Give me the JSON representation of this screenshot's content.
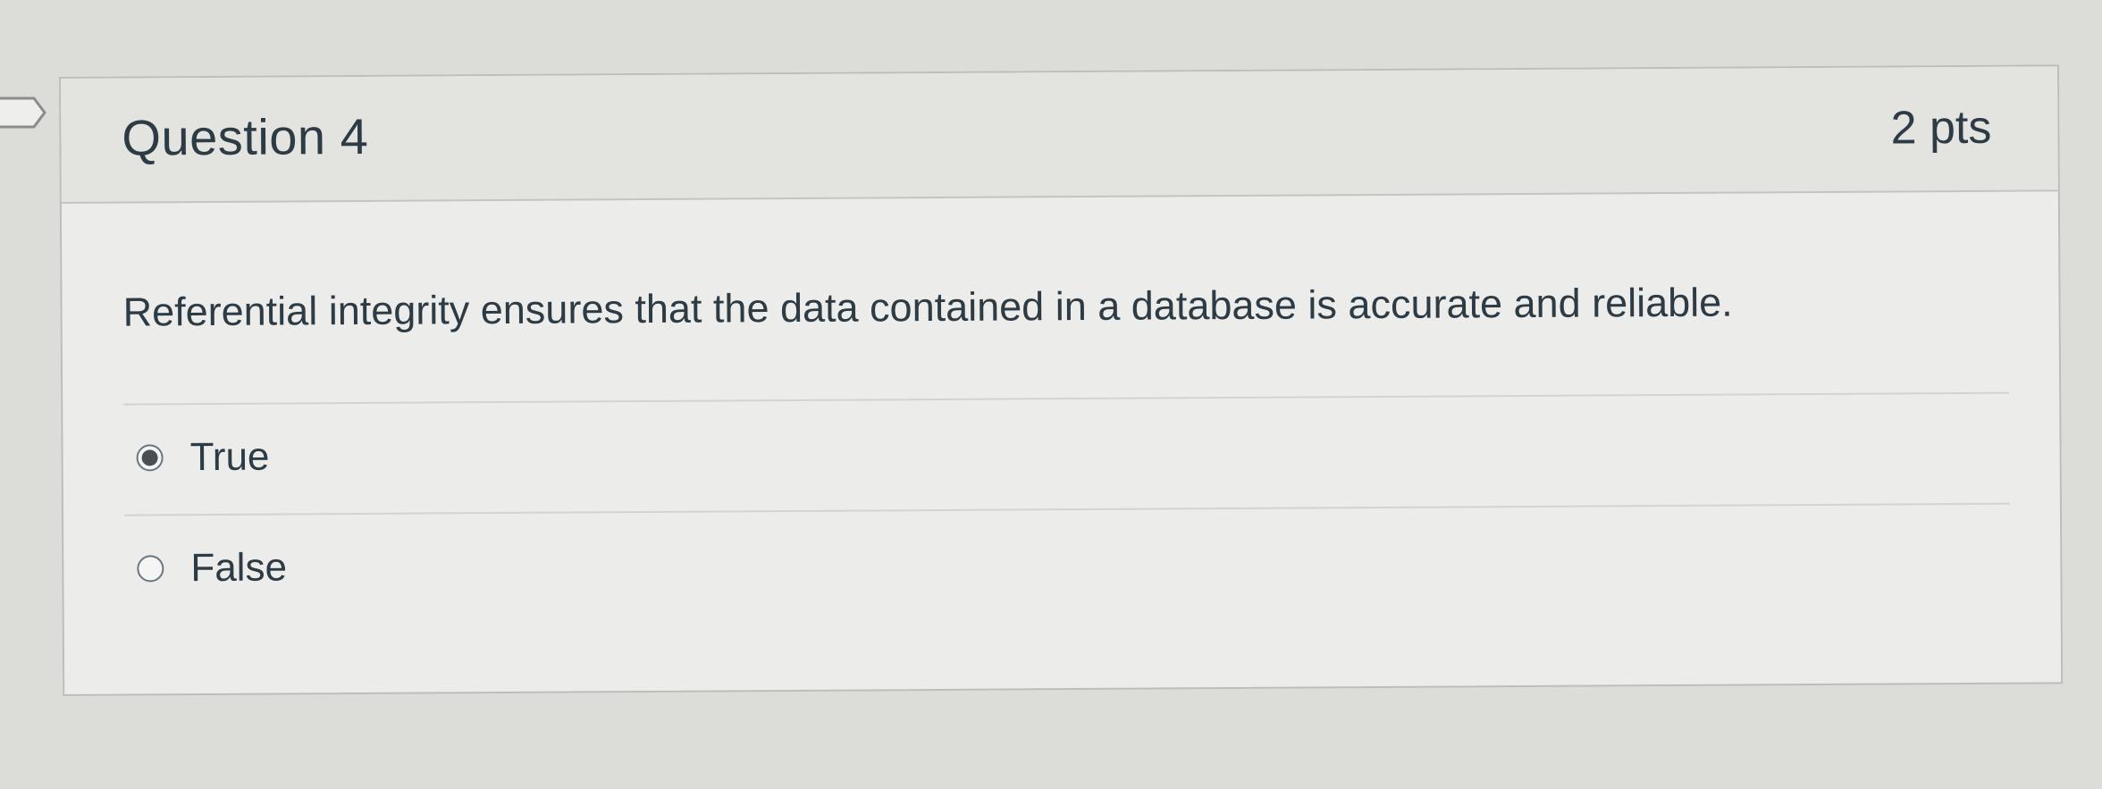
{
  "question": {
    "title": "Question 4",
    "points": "2 pts",
    "text": "Referential integrity ensures that the data contained in a database is accurate and reliable.",
    "answers": [
      {
        "label": "True",
        "selected": true
      },
      {
        "label": "False",
        "selected": false
      }
    ]
  },
  "colors": {
    "text": "#2d3b45",
    "card_background": "#ececea",
    "header_background": "#e3e3e0",
    "border": "#bdbdba"
  }
}
